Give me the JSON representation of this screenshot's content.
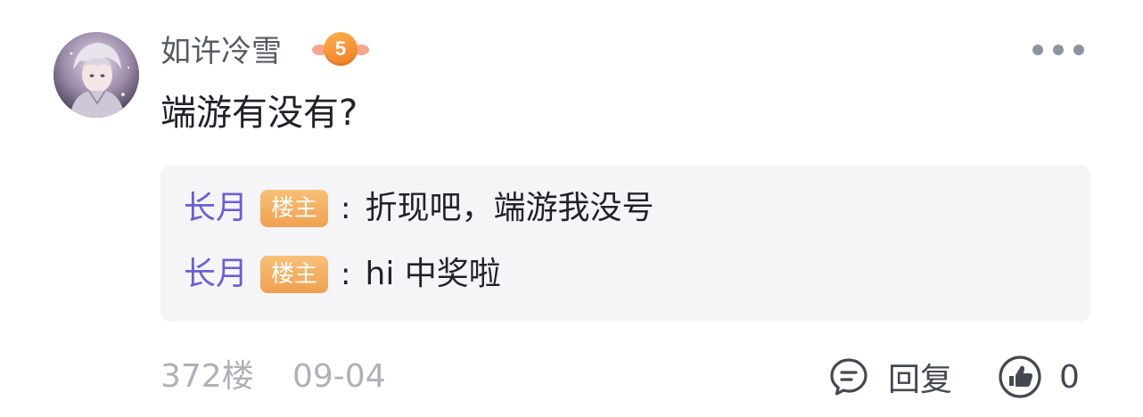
{
  "comment": {
    "username": "如许冷雪",
    "level": "5",
    "content": "端游有没有?",
    "replies": [
      {
        "author": "长月",
        "tag": "楼主",
        "separator": ":",
        "text": "折现吧，端游我没号"
      },
      {
        "author": "长月",
        "tag": "楼主",
        "separator": ":",
        "text": "hi 中奖啦"
      }
    ],
    "floor": "372楼",
    "date": "09-04",
    "reply_label": "回复",
    "like_count": "0"
  },
  "icons": {
    "more": "more-dots-icon",
    "reply": "comment-bubble-icon",
    "like": "thumbs-up-icon",
    "level": "level-badge-icon"
  },
  "colors": {
    "reply_author": "#6a5ed6",
    "op_tag": "#f0a050",
    "level_badge": "#f27a22",
    "muted_text": "#aeb1b7",
    "reply_box_bg": "#f5f5f7"
  }
}
